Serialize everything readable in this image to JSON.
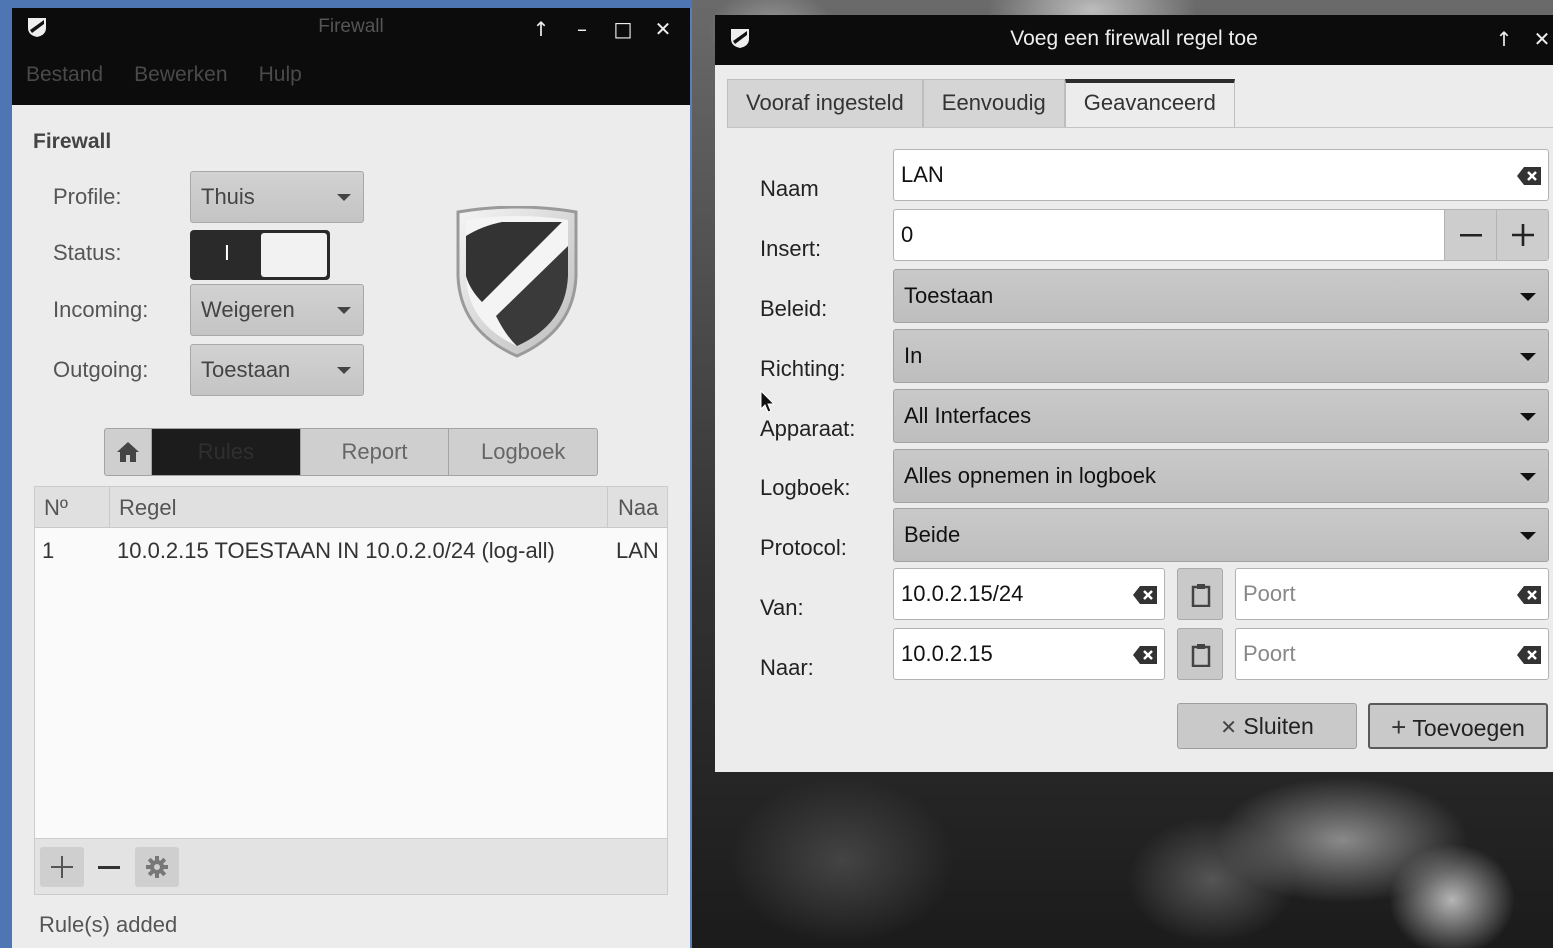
{
  "main_window": {
    "title": "Firewall",
    "title_buttons": {
      "keep_above": "↑",
      "minimize": "–",
      "maximize": "□",
      "close": "✕"
    },
    "menu": [
      "Bestand",
      "Bewerken",
      "Hulp"
    ],
    "section_title": "Firewall",
    "form": {
      "profile_label": "Profile:",
      "profile_value": "Thuis",
      "status_label": "Status:",
      "status_on_mark": "I",
      "incoming_label": "Incoming:",
      "incoming_value": "Weigeren",
      "outgoing_label": "Outgoing:",
      "outgoing_value": "Toestaan"
    },
    "tabs": {
      "rules": "Rules",
      "report": "Report",
      "log": "Logboek",
      "active": "Rules"
    },
    "table": {
      "headers": {
        "num": "Nº",
        "rule": "Regel",
        "name": "Naa"
      },
      "rows": [
        {
          "num": "1",
          "rule": "10.0.2.15 TOESTAAN IN 10.0.2.0/24 (log-all)",
          "name": "LAN"
        }
      ]
    },
    "status_message": "Rule(s) added"
  },
  "dialog": {
    "title": "Voeg een firewall regel toe",
    "title_buttons": {
      "keep_above": "↑",
      "close": "✕"
    },
    "tabs": [
      "Vooraf ingesteld",
      "Eenvoudig",
      "Geavanceerd"
    ],
    "active_tab": "Geavanceerd",
    "fields": {
      "name_label": "Naam",
      "name_value": "LAN",
      "insert_label": "Insert:",
      "insert_value": "0",
      "policy_label": "Beleid:",
      "policy_value": "Toestaan",
      "direction_label": "Richting:",
      "direction_value": "In",
      "interface_label": "Apparaat:",
      "interface_value": "All Interfaces",
      "log_label": "Logboek:",
      "log_value": "Alles opnemen in logboek",
      "protocol_label": "Protocol:",
      "protocol_value": "Beide",
      "from_label": "Van:",
      "from_ip": "10.0.2.15/24",
      "from_port_placeholder": "Poort",
      "to_label": "Naar:",
      "to_ip": "10.0.2.15",
      "to_port_placeholder": "Poort"
    },
    "buttons": {
      "close": "Sluiten",
      "add": "Toevoegen"
    }
  },
  "colors": {
    "titlebar": "#0c0c0c",
    "window_bg": "#ececec",
    "desktop_blue": "#4d76b2"
  }
}
